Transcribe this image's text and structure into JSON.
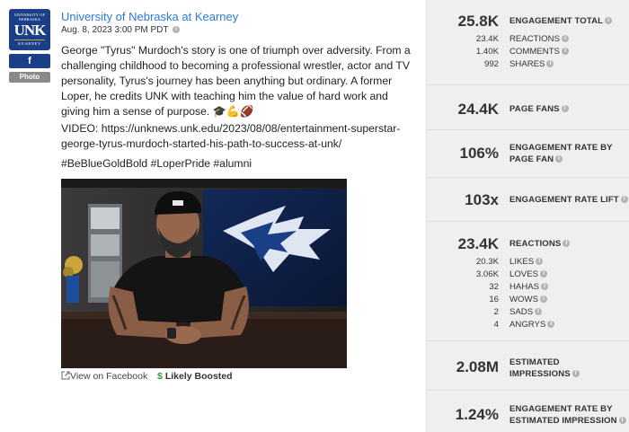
{
  "post": {
    "page_name": "University of Nebraska at Kearney",
    "date": "Aug. 8, 2023 3:00 PM PDT",
    "avatar_lines": [
      "UNIVERSITY OF NEBRASKA",
      "UNK",
      "KEARNEY"
    ],
    "facebook_badge": "f",
    "type_badge": "Photo",
    "body": "George \"Tyrus\" Murdoch's story is one of triumph over adversity. From a challenging childhood to becoming a professional wrestler, actor and TV personality, Tyrus's journey has been anything but ordinary. A former Loper, he credits UNK with teaching him the value of hard work and giving him a sense of purpose. 🎓💪🏈",
    "video_line": "VIDEO: https://unknews.unk.edu/2023/08/08/entertainment-superstar-george-tyrus-murdoch-started-his-path-to-success-at-unk/",
    "hashtags": "#BeBlueGoldBold #LoperPride #alumni",
    "view_on_facebook": "View on Facebook",
    "boosted_label": "Likely Boosted"
  },
  "metrics": {
    "engagement_total": {
      "value": "25.8K",
      "label": "ENGAGEMENT TOTAL"
    },
    "breakdown": [
      {
        "value": "23.4K",
        "label": "REACTIONS"
      },
      {
        "value": "1.40K",
        "label": "COMMENTS"
      },
      {
        "value": "992",
        "label": "SHARES"
      }
    ],
    "page_fans": {
      "value": "24.4K",
      "label": "PAGE FANS"
    },
    "engagement_rate_by_page_fan": {
      "value": "106%",
      "label_line1": "ENGAGEMENT RATE BY",
      "label_line2": "PAGE FAN"
    },
    "engagement_rate_lift": {
      "value": "103x",
      "label": "ENGAGEMENT RATE LIFT"
    },
    "reactions": {
      "value": "23.4K",
      "label": "REACTIONS"
    },
    "reactions_breakdown": [
      {
        "value": "20.3K",
        "label": "LIKES"
      },
      {
        "value": "3.06K",
        "label": "LOVES"
      },
      {
        "value": "32",
        "label": "HAHAS"
      },
      {
        "value": "16",
        "label": "WOWS"
      },
      {
        "value": "2",
        "label": "SADS"
      },
      {
        "value": "4",
        "label": "ANGRYS"
      }
    ],
    "estimated_impressions": {
      "value": "2.08M",
      "label_line1": "ESTIMATED",
      "label_line2": "IMPRESSIONS"
    },
    "engagement_rate_by_impression": {
      "value": "1.24%",
      "label_line1": "ENGAGEMENT RATE BY",
      "label_line2": "ESTIMATED IMPRESSION"
    }
  },
  "colors": {
    "brand_blue": "#1a3f87",
    "link_blue": "#2b7bd4",
    "boost_green": "#2e9b4a",
    "panel_gray": "#efefef"
  }
}
